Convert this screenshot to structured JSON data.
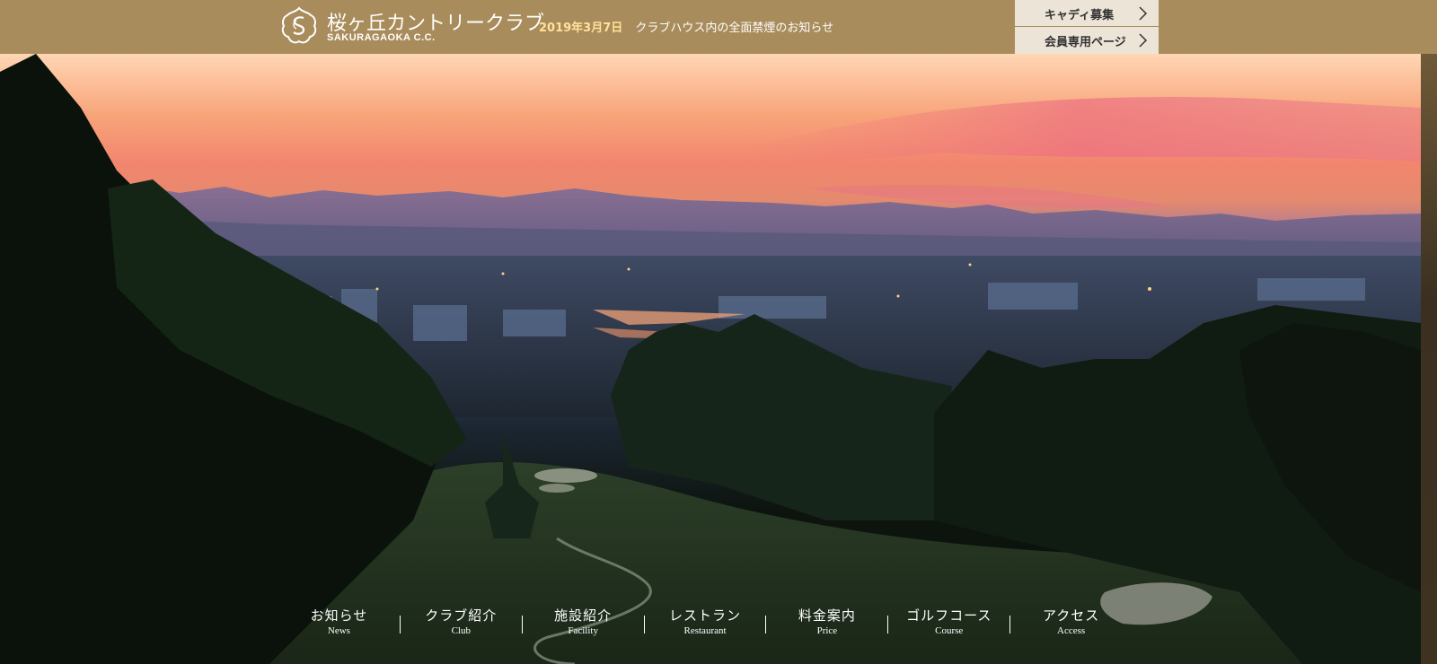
{
  "header": {
    "logo": {
      "name_jp": "桜ヶ丘カントリークラブ",
      "name_en": "SAKURAGAOKA C.C."
    },
    "news": {
      "date": "2019年3月7日",
      "title": "クラブハウス内の全面禁煙のお知らせ"
    },
    "buttons": [
      {
        "label": "キャディ募集",
        "icon": "chevron-right-icon"
      },
      {
        "label": "会員専用ページ",
        "icon": "chevron-right-icon"
      }
    ]
  },
  "nav": {
    "items": [
      {
        "jp": "お知らせ",
        "en": "News"
      },
      {
        "jp": "クラブ紹介",
        "en": "Club"
      },
      {
        "jp": "施設紹介",
        "en": "Facility"
      },
      {
        "jp": "レストラン",
        "en": "Restaurant"
      },
      {
        "jp": "料金案内",
        "en": "Price"
      },
      {
        "jp": "ゴルフコース",
        "en": "Course"
      },
      {
        "jp": "アクセス",
        "en": "Access"
      }
    ]
  },
  "colors": {
    "header_bg": "#a98c5b",
    "news_date": "#ffe29a",
    "button_bg": "#ece4d6"
  }
}
